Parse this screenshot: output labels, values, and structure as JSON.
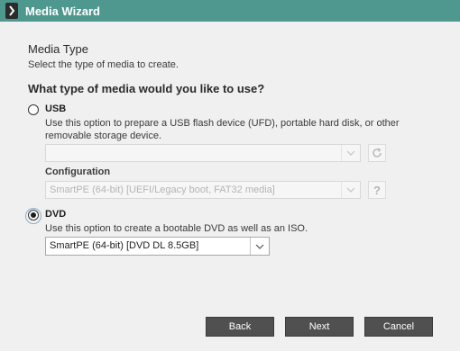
{
  "window": {
    "title": "Media Wizard"
  },
  "page": {
    "heading": "Media Type",
    "subheading": "Select the type of media to create.",
    "question": "What type of media would you like to use?"
  },
  "usb": {
    "label": "USB",
    "selected": false,
    "description_line1": "Use this option to prepare a USB flash device (UFD), portable hard disk, or other",
    "description_line2": "removable storage device.",
    "device_value": "",
    "configuration_label": "Configuration",
    "configuration_value": "SmartPE (64-bit) [UEFI/Legacy boot, FAT32 media]",
    "refresh_icon": "refresh-icon",
    "help_glyph": "?"
  },
  "dvd": {
    "label": "DVD",
    "selected": true,
    "description": "Use this option to create a bootable DVD as well as an ISO.",
    "media_value": "SmartPE (64-bit) [DVD DL 8.5GB]"
  },
  "buttons": {
    "back": "Back",
    "next": "Next",
    "cancel": "Cancel"
  },
  "colors": {
    "titlebar": "#4f9890",
    "button": "#505050",
    "background": "#f0f0f0"
  }
}
